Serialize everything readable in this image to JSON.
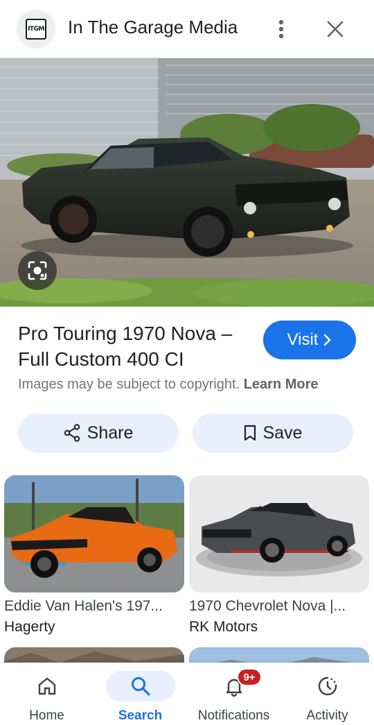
{
  "header": {
    "logo_text": "ITGM",
    "site_name": "In The Garage Media"
  },
  "result": {
    "title": "Pro Touring 1970 Nova – Full Custom 400 CI",
    "visit_label": "Visit",
    "copyright_text": "Images may be subject to copyright.",
    "learn_more_label": "Learn More"
  },
  "actions": {
    "share_label": "Share",
    "save_label": "Save"
  },
  "related": [
    {
      "title": "Eddie Van Halen's 197...",
      "source": "Hagerty",
      "car_color": "#e86a12"
    },
    {
      "title": "1970 Chevrolet Nova |...",
      "source": "RK Motors",
      "car_color": "#4a4d50"
    }
  ],
  "nav": {
    "items": [
      {
        "label": "Home",
        "icon": "home-icon",
        "active": false
      },
      {
        "label": "Search",
        "icon": "search-icon",
        "active": true
      },
      {
        "label": "Notifications",
        "icon": "bell-icon",
        "active": false,
        "badge": "9+"
      },
      {
        "label": "Activity",
        "icon": "activity-icon",
        "active": false
      }
    ]
  },
  "colors": {
    "accent": "#1a73e8",
    "tonal": "#e8f0fe",
    "badge": "#c5221f"
  }
}
